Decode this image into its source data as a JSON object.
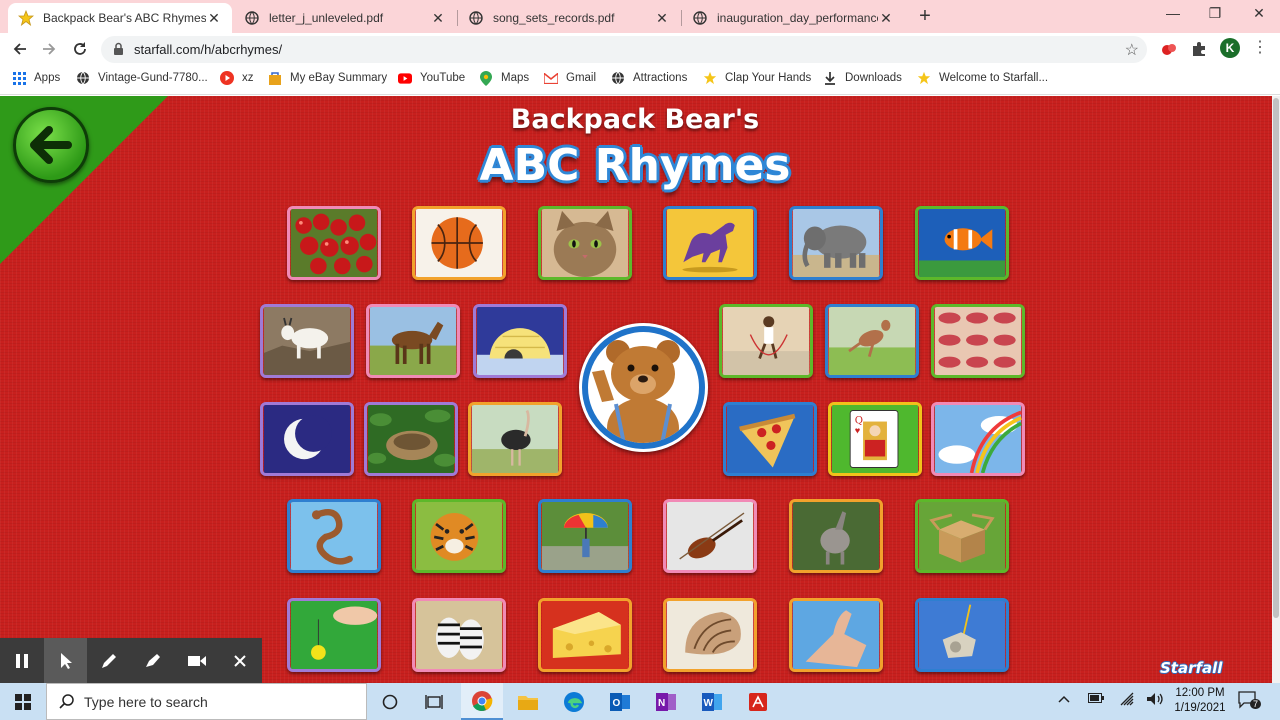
{
  "browser": {
    "tabs": [
      {
        "title": "Backpack Bear's ABC Rhymes!",
        "active": true
      },
      {
        "title": "letter_j_unleveled.pdf",
        "active": false
      },
      {
        "title": "song_sets_records.pdf",
        "active": false
      },
      {
        "title": "inauguration_day_performances",
        "active": false
      }
    ],
    "url": "starfall.com/h/abcrhymes/",
    "profile_initial": "K",
    "bookmarks": [
      "Apps",
      "Vintage-Gund-7780...",
      "xz",
      "My eBay Summary",
      "YouTube",
      "Maps",
      "Gmail",
      "Attractions",
      "Clap Your Hands",
      "Downloads",
      "Welcome to Starfall..."
    ]
  },
  "page": {
    "title_line1": "Backpack Bear's",
    "title_line2": "ABC Rhymes",
    "logo_text": "Starfall",
    "tiles": [
      {
        "name": "apples"
      },
      {
        "name": "basketball"
      },
      {
        "name": "cat"
      },
      {
        "name": "dinosaur"
      },
      {
        "name": "elephant"
      },
      {
        "name": "fish"
      },
      {
        "name": "goat"
      },
      {
        "name": "horse"
      },
      {
        "name": "igloo"
      },
      {
        "name": "jump-rope"
      },
      {
        "name": "kangaroo"
      },
      {
        "name": "lips"
      },
      {
        "name": "moon"
      },
      {
        "name": "nest"
      },
      {
        "name": "ostrich"
      },
      {
        "name": "pizza"
      },
      {
        "name": "queen"
      },
      {
        "name": "rainbow"
      },
      {
        "name": "snake"
      },
      {
        "name": "tiger"
      },
      {
        "name": "umbrella"
      },
      {
        "name": "violin"
      },
      {
        "name": "wolf"
      },
      {
        "name": "box"
      },
      {
        "name": "yo-yo"
      },
      {
        "name": "zebra"
      },
      {
        "name": "cheese"
      },
      {
        "name": "shell"
      },
      {
        "name": "thumb"
      },
      {
        "name": "whistle"
      }
    ]
  },
  "taskbar": {
    "search_placeholder": "Type here to search",
    "time": "12:00 PM",
    "date": "1/19/2021",
    "notifications": "7"
  }
}
